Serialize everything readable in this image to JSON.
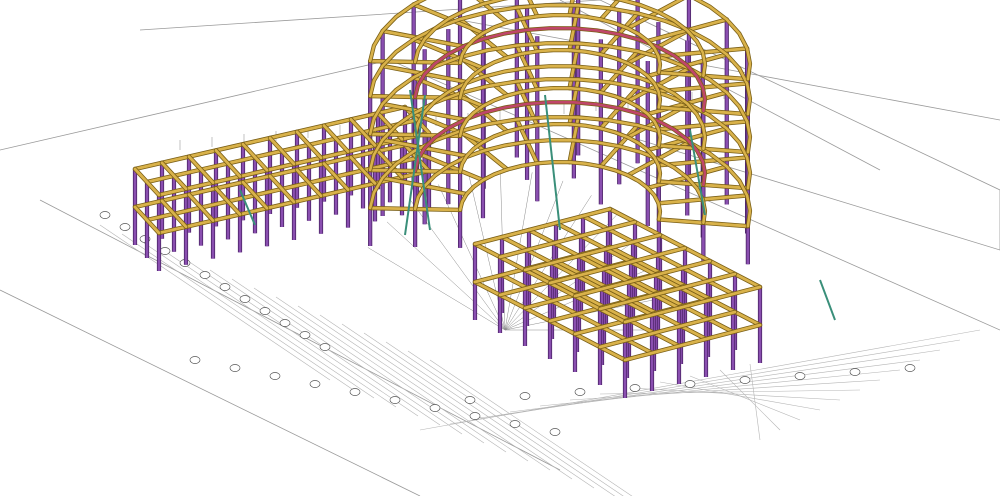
{
  "view": {
    "type": "3D structural steel frame model (isometric view) over plan drawing sheets",
    "colors": {
      "background": "#ffffff",
      "sheet_lines": "#9a9a9a",
      "dim_lines": "#b5b5b5",
      "beam_fill": "#d9b24a",
      "beam_edge": "#7a5f16",
      "column_fill": "#8a4fb0",
      "column_edge": "#4a2266",
      "bracing": "#3a8f7a",
      "curved_beam": "#c0466a",
      "grid_bubble": "#555555"
    }
  },
  "structure": {
    "wings": [
      "left-wing",
      "curved-center-block",
      "right-wing"
    ],
    "members": [
      "beam",
      "column",
      "bracing",
      "curved-beam"
    ]
  }
}
